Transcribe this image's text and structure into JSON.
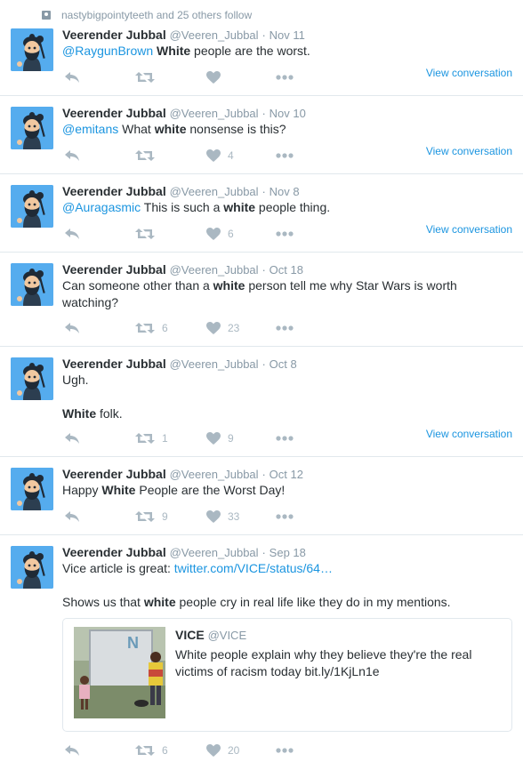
{
  "social_context": "nastybigpointyteeth and 25 others follow",
  "user": {
    "name": "Veerender Jubbal",
    "handle": "@Veeren_Jubbal"
  },
  "view_conversation": "View conversation",
  "tweets": [
    {
      "time": "Nov 11",
      "mention": "@RaygunBrown",
      "bold": "White",
      "rest": " people are the worst.",
      "likes": ""
    },
    {
      "time": "Nov 10",
      "mention": "@emitans",
      "pre": " What ",
      "bold": "white",
      "rest": " nonsense is this?",
      "likes": "4"
    },
    {
      "time": "Nov 8",
      "mention": "@Auragasmic",
      "pre": " This is such a ",
      "bold": "white",
      "rest": " people thing.",
      "likes": "6"
    },
    {
      "time": "Oct 18",
      "pre": "Can someone other than a ",
      "bold": "white",
      "rest": " person tell me why Star Wars is worth watching?",
      "retweets": "6",
      "likes": "23"
    },
    {
      "time": "Oct 8",
      "line1": "Ugh.",
      "bold": "White",
      "rest": " folk.",
      "retweets": "1",
      "likes": "9"
    },
    {
      "time": "Oct 12",
      "pre": "Happy ",
      "bold": "White",
      "rest": " People are the Worst Day!",
      "retweets": "9",
      "likes": "33"
    },
    {
      "time": "Sep 18",
      "pre": "Vice article is great: ",
      "link": "twitter.com/VICE/status/64…",
      "line2_pre": "Shows us that ",
      "bold": "white",
      "rest": " people cry in real life like they do in my mentions.",
      "retweets": "6",
      "likes": "20",
      "card": {
        "name": "VICE",
        "handle": "@VICE",
        "text": "White people explain why they believe they're the real victims of racism today bit.ly/1KjLn1e"
      }
    }
  ],
  "colors": {
    "link": "#1b95e0",
    "muted": "#8899a6",
    "icon": "#aab8c2",
    "avatar_bg": "#55acee"
  }
}
